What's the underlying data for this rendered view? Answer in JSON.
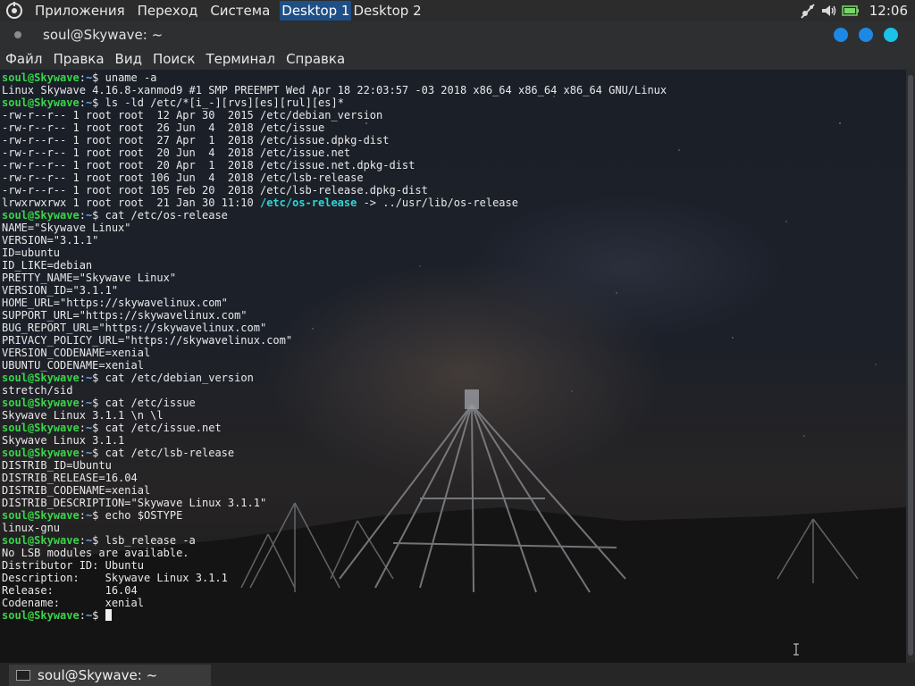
{
  "top_panel": {
    "menu": [
      "Приложения",
      "Переход",
      "Система"
    ],
    "desktops": [
      {
        "label": "Desktop 1",
        "active": true
      },
      {
        "label": "Desktop 2",
        "active": false
      }
    ],
    "tray_icons": [
      "network-icon",
      "volume-icon",
      "battery-icon"
    ],
    "clock": "12:06"
  },
  "window": {
    "title": "soul@Skywave: ~",
    "menu": [
      "Файл",
      "Правка",
      "Вид",
      "Поиск",
      "Терминал",
      "Справка"
    ]
  },
  "terminal": {
    "prompt_user": "soul@Skywave",
    "prompt_path": "~",
    "colors": {
      "user": "#39d44a",
      "path": "#5fa7ff",
      "link": "#2fd6d6",
      "text": "#e9e9e9"
    },
    "lines": [
      {
        "kind": "prompt",
        "text": "uname -a"
      },
      {
        "kind": "out",
        "text": "Linux Skywave 4.16.8-xanmod9 #1 SMP PREEMPT Wed Apr 18 22:03:57 -03 2018 x86_64 x86_64 x86_64 GNU/Linux"
      },
      {
        "kind": "prompt",
        "text": "ls -ld /etc/*[i_-][rvs][es][rul][es]*"
      },
      {
        "kind": "out",
        "text": "-rw-r--r-- 1 root root  12 Apr 30  2015 /etc/debian_version"
      },
      {
        "kind": "out",
        "text": "-rw-r--r-- 1 root root  26 Jun  4  2018 /etc/issue"
      },
      {
        "kind": "out",
        "text": "-rw-r--r-- 1 root root  27 Apr  1  2018 /etc/issue.dpkg-dist"
      },
      {
        "kind": "out",
        "text": "-rw-r--r-- 1 root root  20 Jun  4  2018 /etc/issue.net"
      },
      {
        "kind": "out",
        "text": "-rw-r--r-- 1 root root  20 Apr  1  2018 /etc/issue.net.dpkg-dist"
      },
      {
        "kind": "out",
        "text": "-rw-r--r-- 1 root root 106 Jun  4  2018 /etc/lsb-release"
      },
      {
        "kind": "out",
        "text": "-rw-r--r-- 1 root root 105 Feb 20  2018 /etc/lsb-release.dpkg-dist"
      },
      {
        "kind": "link",
        "pre": "lrwxrwxrwx 1 root root  21 Jan 30 11:10 ",
        "link": "/etc/os-release",
        "post": " -> ../usr/lib/os-release"
      },
      {
        "kind": "prompt",
        "text": "cat /etc/os-release"
      },
      {
        "kind": "out",
        "text": "NAME=\"Skywave Linux\""
      },
      {
        "kind": "out",
        "text": "VERSION=\"3.1.1\""
      },
      {
        "kind": "out",
        "text": "ID=ubuntu"
      },
      {
        "kind": "out",
        "text": "ID_LIKE=debian"
      },
      {
        "kind": "out",
        "text": "PRETTY_NAME=\"Skywave Linux\""
      },
      {
        "kind": "out",
        "text": "VERSION_ID=\"3.1.1\""
      },
      {
        "kind": "out",
        "text": "HOME_URL=\"https://skywavelinux.com\""
      },
      {
        "kind": "out",
        "text": "SUPPORT_URL=\"https://skywavelinux.com\""
      },
      {
        "kind": "out",
        "text": "BUG_REPORT_URL=\"https://skywavelinux.com\""
      },
      {
        "kind": "out",
        "text": "PRIVACY_POLICY_URL=\"https://skywavelinux.com\""
      },
      {
        "kind": "out",
        "text": "VERSION_CODENAME=xenial"
      },
      {
        "kind": "out",
        "text": "UBUNTU_CODENAME=xenial"
      },
      {
        "kind": "prompt",
        "text": "cat /etc/debian_version"
      },
      {
        "kind": "out",
        "text": "stretch/sid"
      },
      {
        "kind": "prompt",
        "text": "cat /etc/issue"
      },
      {
        "kind": "out",
        "text": "Skywave Linux 3.1.1 \\n \\l"
      },
      {
        "kind": "prompt",
        "text": "cat /etc/issue.net"
      },
      {
        "kind": "out",
        "text": "Skywave Linux 3.1.1"
      },
      {
        "kind": "prompt",
        "text": "cat /etc/lsb-release"
      },
      {
        "kind": "out",
        "text": "DISTRIB_ID=Ubuntu"
      },
      {
        "kind": "out",
        "text": "DISTRIB_RELEASE=16.04"
      },
      {
        "kind": "out",
        "text": "DISTRIB_CODENAME=xenial"
      },
      {
        "kind": "out",
        "text": "DISTRIB_DESCRIPTION=\"Skywave Linux 3.1.1\""
      },
      {
        "kind": "prompt",
        "text": "echo $OSTYPE"
      },
      {
        "kind": "out",
        "text": "linux-gnu"
      },
      {
        "kind": "prompt",
        "text": "lsb_release -a"
      },
      {
        "kind": "out",
        "text": "No LSB modules are available."
      },
      {
        "kind": "out",
        "text": "Distributor ID:\tUbuntu"
      },
      {
        "kind": "out",
        "text": "Description:\tSkywave Linux 3.1.1"
      },
      {
        "kind": "out",
        "text": "Release:\t16.04"
      },
      {
        "kind": "out",
        "text": "Codename:\txenial"
      },
      {
        "kind": "prompt",
        "text": "",
        "cursor": true
      }
    ]
  },
  "taskbar": {
    "items": [
      {
        "label": "soul@Skywave: ~",
        "icon": "terminal-icon"
      }
    ]
  }
}
